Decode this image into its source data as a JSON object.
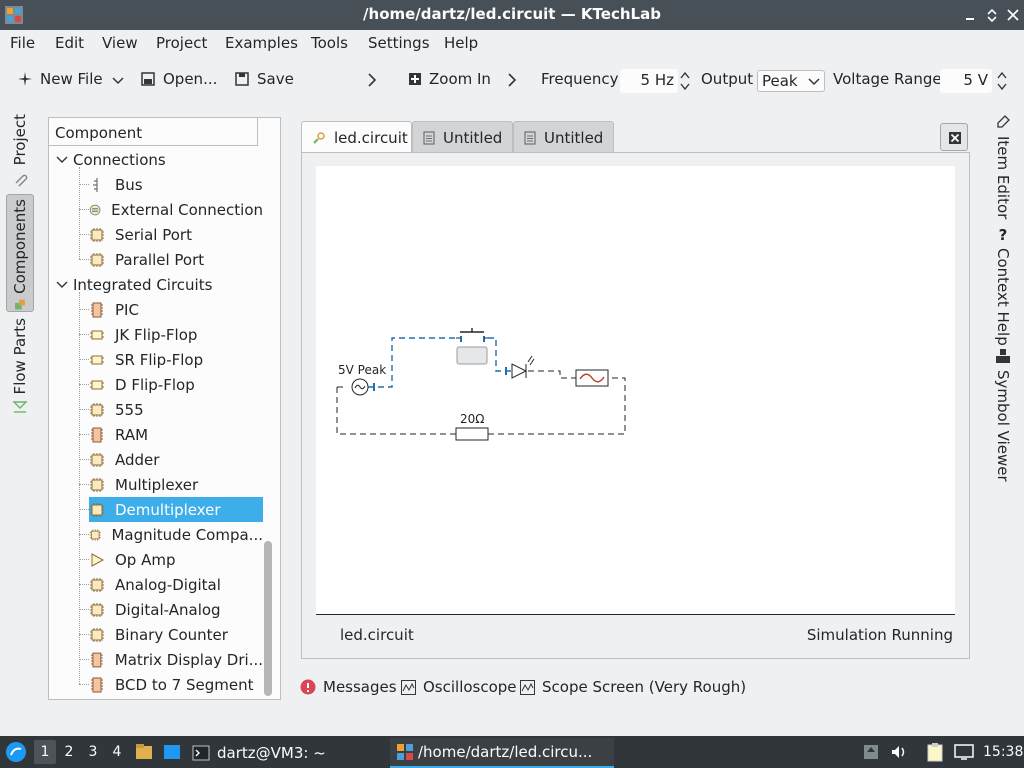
{
  "window": {
    "title": "/home/dartz/led.circuit — KTechLab"
  },
  "menu": [
    "File",
    "Edit",
    "View",
    "Project",
    "Examples",
    "Tools",
    "Settings",
    "Help"
  ],
  "toolbar": {
    "new_file": "New File",
    "open": "Open...",
    "save": "Save",
    "zoom_in": "Zoom In",
    "frequency_label": "Frequency",
    "frequency_value": "5 Hz",
    "output_label": "Output",
    "output_value": "Peak",
    "voltage_label": "Voltage Range",
    "voltage_value": "5 V"
  },
  "left_tabs": [
    "Project",
    "Components",
    "Flow Parts"
  ],
  "component_panel": {
    "header": "Component",
    "tree": [
      {
        "type": "cat",
        "label": "Connections"
      },
      {
        "type": "item",
        "label": "Bus",
        "icon": "bus-icon"
      },
      {
        "type": "item",
        "label": "External Connection",
        "icon": "external-connection-icon"
      },
      {
        "type": "item",
        "label": "Serial Port",
        "icon": "chip-icon"
      },
      {
        "type": "item",
        "label": "Parallel Port",
        "icon": "chip-icon"
      },
      {
        "type": "cat",
        "label": "Integrated Circuits"
      },
      {
        "type": "item",
        "label": "PIC",
        "icon": "dip-chip-icon"
      },
      {
        "type": "item",
        "label": "JK Flip-Flop",
        "icon": "flipflop-icon"
      },
      {
        "type": "item",
        "label": "SR Flip-Flop",
        "icon": "flipflop-icon"
      },
      {
        "type": "item",
        "label": "D Flip-Flop",
        "icon": "flipflop-icon"
      },
      {
        "type": "item",
        "label": "555",
        "icon": "chip-icon"
      },
      {
        "type": "item",
        "label": "RAM",
        "icon": "dip-chip-icon"
      },
      {
        "type": "item",
        "label": "Adder",
        "icon": "chip-icon"
      },
      {
        "type": "item",
        "label": "Multiplexer",
        "icon": "chip-icon"
      },
      {
        "type": "item",
        "label": "Demultiplexer",
        "icon": "chip-icon",
        "selected": true
      },
      {
        "type": "item",
        "label": "Magnitude Compa...",
        "icon": "chip-icon"
      },
      {
        "type": "item",
        "label": "Op Amp",
        "icon": "opamp-icon"
      },
      {
        "type": "item",
        "label": "Analog-Digital",
        "icon": "chip-icon"
      },
      {
        "type": "item",
        "label": "Digital-Analog",
        "icon": "chip-icon"
      },
      {
        "type": "item",
        "label": "Binary Counter",
        "icon": "chip-icon"
      },
      {
        "type": "item",
        "label": "Matrix Display Dri...",
        "icon": "dip-chip-icon"
      },
      {
        "type": "item",
        "label": "BCD to 7 Segment",
        "icon": "dip-chip-icon"
      }
    ]
  },
  "doc_tabs": [
    "led.circuit",
    "Untitled",
    "Untitled"
  ],
  "circuit": {
    "source_label": "5V Peak",
    "resistor_label": "20Ω"
  },
  "status": {
    "left": "led.circuit",
    "right": "Simulation Running"
  },
  "bottom_tabs": [
    "Messages",
    "Oscilloscope",
    "Scope Screen (Very Rough)"
  ],
  "right_tabs": [
    "Item Editor",
    "Context Help",
    "Symbol Viewer"
  ],
  "taskbar": {
    "desktops": [
      "1",
      "2",
      "3",
      "4"
    ],
    "terminal": "dartz@VM3: ~",
    "app": "/home/dartz/led.circu...",
    "clock": "15:38"
  }
}
